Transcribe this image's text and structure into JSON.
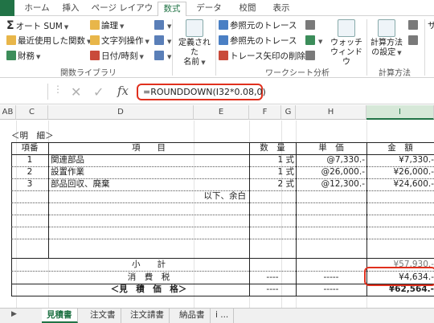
{
  "ribbon_tabs": [
    "ホーム",
    "挿入",
    "ページ レイアウト",
    "数式",
    "データ",
    "校閲",
    "表示"
  ],
  "active_tab_index": 3,
  "ribbon": {
    "library": {
      "autosum": "オート SUM",
      "recent": "最近使用した関数",
      "finance": "財務",
      "logical": "論理",
      "text": "文字列操作",
      "datetime": "日付/時刻",
      "group_label": "関数ライブラリ"
    },
    "names": {
      "defined_names_1": "定義された",
      "defined_names_2": "名前"
    },
    "audit": {
      "trace_precedents": "参照元のトレース",
      "trace_dependents": "参照先のトレース",
      "remove_arrows": "トレース矢印の削除",
      "watch_1": "ウォッチ",
      "watch_2": "ウィンドウ",
      "group_label": "ワークシート分析"
    },
    "calc": {
      "options_1": "計算方法",
      "options_2": "の設定",
      "group_label": "計算方法"
    },
    "partial_right": "サ"
  },
  "formula_bar": {
    "formula": "=ROUNDDOWN(I32*0.08,0)",
    "fx": "fx"
  },
  "columns": [
    "AB",
    "C",
    "D",
    "E",
    "F",
    "G",
    "H",
    "I"
  ],
  "sheet": {
    "section_title": "＜明　細＞",
    "headers": [
      "項番",
      "項　　目",
      "数　量",
      "単　価",
      "金　額"
    ],
    "rows": [
      {
        "no": "1",
        "item": "関連部品",
        "qty": "1 式",
        "price": "@7,330.-",
        "amount": "¥7,330.-"
      },
      {
        "no": "2",
        "item": "設置作業",
        "qty": "1 式",
        "price": "@26,000.-",
        "amount": "¥26,000.-"
      },
      {
        "no": "3",
        "item": "部品回収、廃棄",
        "qty": "2 式",
        "price": "@12,300.-",
        "amount": "¥24,600.-"
      }
    ],
    "note": "以下、余白",
    "subtotal_label": "小　　計",
    "subtotal_amount": "¥57,930.-",
    "tax_label": "消　費　税",
    "tax_qty": "----",
    "tax_price": "-----",
    "tax_amount": "¥4,634.-",
    "total_label": "＜見　積　価　格＞",
    "total_qty": "----",
    "total_price": "-----",
    "total_amount": "¥62,564.-"
  },
  "sheet_tabs": [
    "見積書",
    "注文書",
    "注文請書",
    "納品書",
    "i ..."
  ],
  "active_sheet_index": 0,
  "colors": {
    "accent": "#217346",
    "highlight": "#e0301e"
  }
}
